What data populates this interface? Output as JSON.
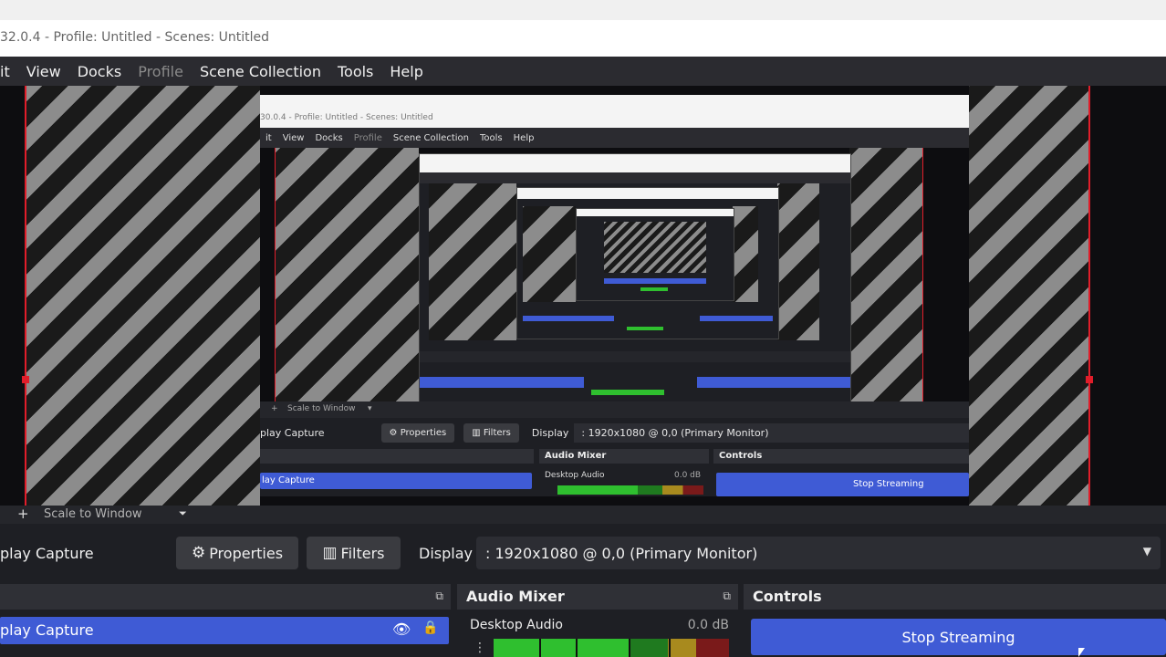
{
  "window": {
    "title": "32.0.4 - Profile: Untitled - Scenes: Untitled"
  },
  "menu": {
    "items": [
      "it",
      "View",
      "Docks",
      "Profile",
      "Scene Collection",
      "Tools",
      "Help"
    ]
  },
  "nested_preview": {
    "title": "30.0.4 - Profile: Untitled - Scenes: Untitled",
    "menu_items": [
      "it",
      "View",
      "Docks",
      "Profile",
      "Scene Collection",
      "Tools",
      "Help"
    ],
    "scale_label": "Scale to Window",
    "source_name": "play Capture",
    "properties_label": "Properties",
    "filters_label": "Filters",
    "display_label": "Display",
    "display_value": ": 1920x1080 @ 0,0 (Primary Monitor)",
    "audio_mixer_label": "Audio Mixer",
    "controls_label": "Controls",
    "scene_item": "lay Capture",
    "desktop_audio": "Desktop Audio",
    "db_value": "0.0 dB",
    "stop_label": "Stop Streaming"
  },
  "preview_bar": {
    "plus": "+",
    "scale_label": "Scale to Window",
    "caret": "⏷"
  },
  "source_toolbar": {
    "source_name": "play Capture",
    "properties_label": "Properties",
    "filters_label": "Filters",
    "display_label": "Display",
    "display_value": ": 1920x1080 @ 0,0 (Primary Monitor)"
  },
  "sources_panel": {
    "item_name": "play Capture",
    "visibility_icon": "eye-icon",
    "lock_icon": "lock-icon"
  },
  "audio_mixer": {
    "title": "Audio Mixer",
    "channel_name": "Desktop Audio",
    "db_value": "0.0 dB",
    "level": 0.74
  },
  "controls": {
    "title": "Controls",
    "stop_streaming_label": "Stop Streaming"
  },
  "colors": {
    "accent": "#3f5bd5",
    "selection_border": "#e11d2a",
    "panel_bg": "#1e1f24"
  }
}
